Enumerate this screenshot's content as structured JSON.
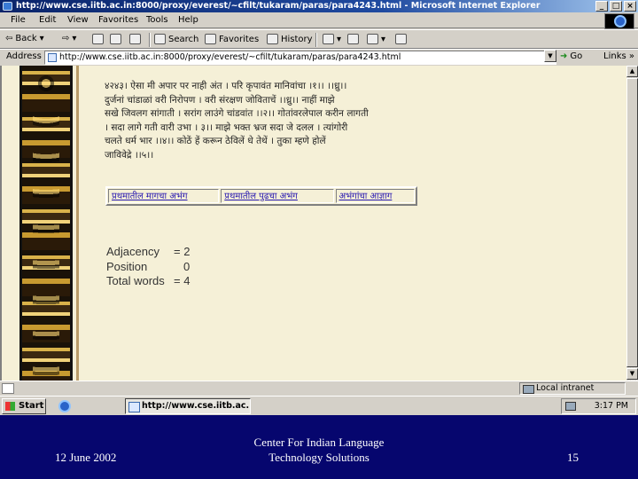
{
  "window": {
    "title": "http://www.cse.iitb.ac.in:8000/proxy/everest/~cfilt/tukaram/paras/para4243.html - Microsoft Internet Explorer",
    "buttons": {
      "minimize": "_",
      "maximize": "□",
      "close": "×"
    }
  },
  "menubar": {
    "items": [
      "File",
      "Edit",
      "View",
      "Favorites",
      "Tools",
      "Help"
    ]
  },
  "toolbar": {
    "back": "Back",
    "search": "Search",
    "favorites": "Favorites",
    "history": "History"
  },
  "addressbar": {
    "label": "Address",
    "url": "http://www.cse.iitb.ac.in:8000/proxy/everest/~cfilt/tukaram/paras/para4243.html",
    "go": "Go",
    "links": "Links »"
  },
  "content": {
    "devanagari_lines": [
      "४२४३। ऐसा मी अपार पर नाही अंत । परि कृपावंत मानिवांचा ।१।। ।।ध्रु।।",
      "दुर्जनां चांडाळां वरी निरोपण । वरी संरक्षण जोविताचें ।।ध्रु।। नाहीं माझे",
      "सखे जिवलग सांगाती । सरांग लाउंगे चांडवांत ।।२।। गोतांवरलेपाल करीन लागती",
      "। सदा लागे गती वारी उभा । ३।। माझे भक्त भ्रज सदा जे दलल । त्यांगोरी",
      "चलते धर्म भार ।।४।। कोठें हें करून ठेविलें धे तेथें । तुका म्हणे होलें",
      "जाविवेद्रे ।।५।।"
    ],
    "links": [
      "प्रथमातील मागचा अभंग",
      "प्रथमातील पुढचा अभंग",
      "अभंगांचा आज्ञाग"
    ],
    "stats": [
      {
        "label": "Adjacency",
        "value": "= 2"
      },
      {
        "label": "Position",
        "value": "0"
      },
      {
        "label": "Total words",
        "value": "= 4"
      }
    ]
  },
  "statusbar": {
    "zone": "Local intranet"
  },
  "taskbar": {
    "start": "Start",
    "task": "http://www.cse.iitb.ac...",
    "time": "3:17 PM"
  },
  "footer": {
    "date": "12 June 2002",
    "org_line1": "Center For Indian Language",
    "org_line2": "Technology Solutions",
    "page": "15"
  }
}
